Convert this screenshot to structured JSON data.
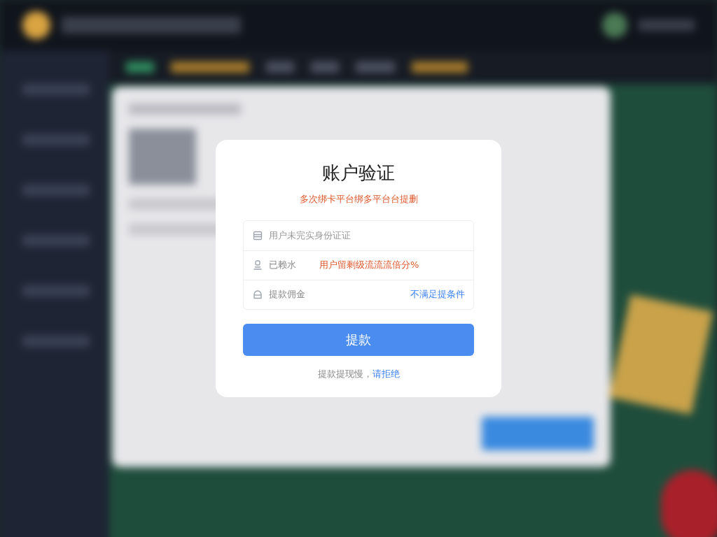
{
  "dialog": {
    "title": "账户验证",
    "warning": "多次绑卡平台绑多平台台提删",
    "fields": [
      {
        "kind": "input",
        "placeholder": "用户未完实身份证证"
      },
      {
        "kind": "note",
        "label": "已赖水",
        "note": "用户留剩级流流流倍分%"
      },
      {
        "kind": "link",
        "label": "提款佣金",
        "link": "不满足提条件"
      }
    ],
    "button": "提款",
    "footer": {
      "text": "提款提现慢，",
      "link": "请拒绝"
    }
  }
}
